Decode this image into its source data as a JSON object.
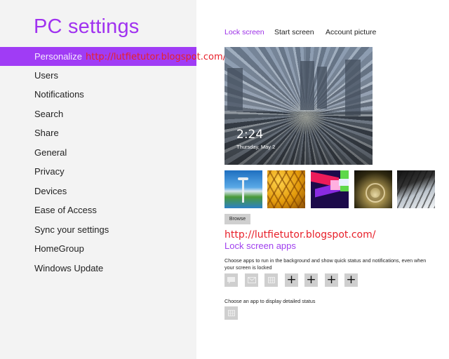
{
  "app": {
    "title": "PC settings"
  },
  "sidebar": {
    "items": [
      {
        "label": "Personalize",
        "active": true
      },
      {
        "label": "Users"
      },
      {
        "label": "Notifications"
      },
      {
        "label": "Search"
      },
      {
        "label": "Share"
      },
      {
        "label": "General"
      },
      {
        "label": "Privacy"
      },
      {
        "label": "Devices"
      },
      {
        "label": "Ease of Access"
      },
      {
        "label": "Sync your settings"
      },
      {
        "label": "HomeGroup"
      },
      {
        "label": "Windows Update"
      }
    ]
  },
  "watermarks": {
    "top": "http://lutfietutor.blogspot.com/",
    "middle": "http://lutfietutor.blogspot.com/"
  },
  "tabs": [
    {
      "label": "Lock screen",
      "active": true
    },
    {
      "label": "Start screen"
    },
    {
      "label": "Account picture"
    }
  ],
  "lock_preview": {
    "time": "2:24",
    "date": "Thursday, May 2"
  },
  "thumbnails": [
    {
      "name": "space-needle"
    },
    {
      "name": "honeycomb"
    },
    {
      "name": "geometric-color"
    },
    {
      "name": "nautilus-shell"
    },
    {
      "name": "piano-keys"
    }
  ],
  "browse_button": "Browse",
  "lock_screen_apps": {
    "title": "Lock screen apps",
    "description": "Choose apps to run in the background and show quick status and notifications, even when your screen is locked",
    "slots": [
      {
        "icon": "messaging-icon"
      },
      {
        "icon": "mail-icon"
      },
      {
        "icon": "calendar-icon"
      },
      {
        "icon": "plus-icon",
        "label": "+"
      },
      {
        "icon": "plus-icon",
        "label": "+"
      },
      {
        "icon": "plus-icon",
        "label": "+"
      },
      {
        "icon": "plus-icon",
        "label": "+"
      }
    ],
    "detailed_status_label": "Choose an app to display detailed status",
    "detailed_status_app": "calendar-icon"
  },
  "colors": {
    "accent": "#a03cf5",
    "title": "#a032f0",
    "watermark": "#e8202a",
    "sidebar_bg": "#f3f3f3",
    "slot_bg": "#cfcfcf"
  }
}
